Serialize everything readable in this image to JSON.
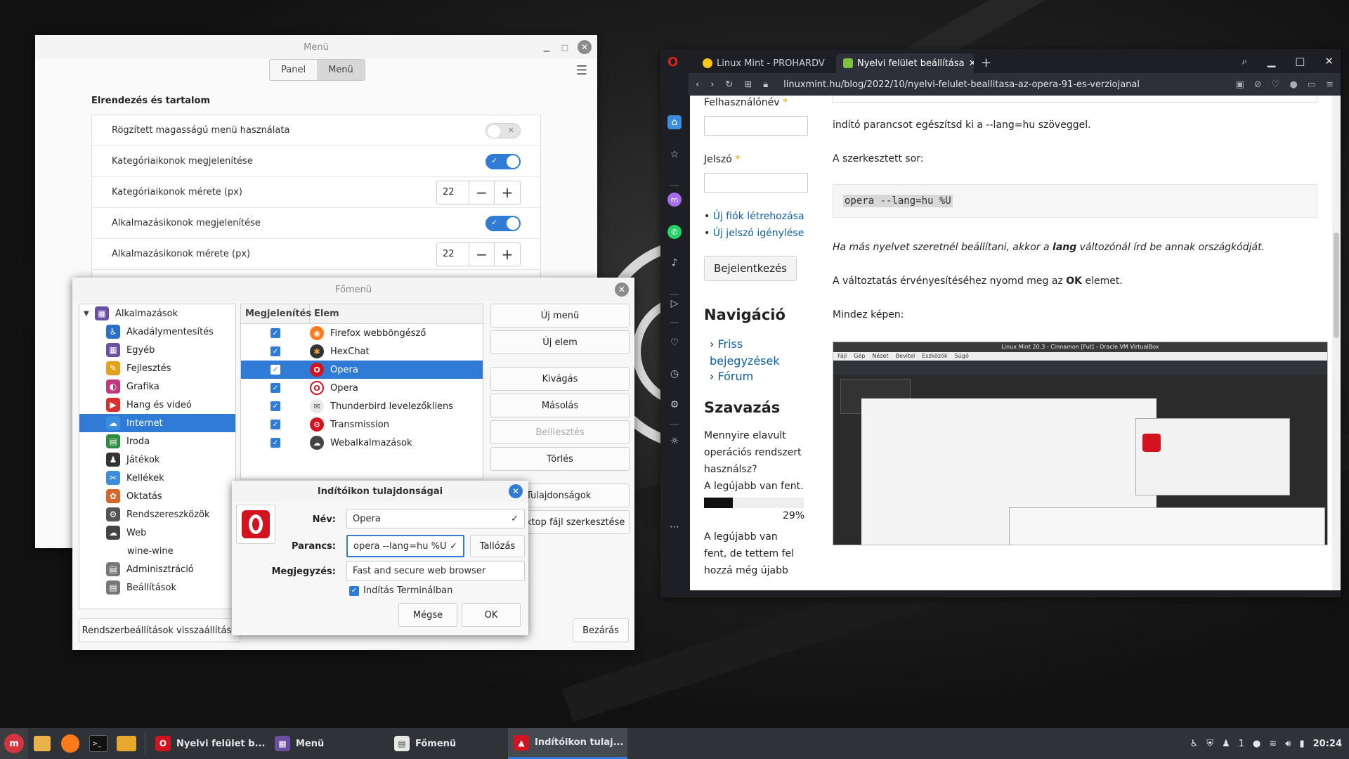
{
  "menu_window": {
    "title": "Menü",
    "tabs": [
      {
        "label": "Panel"
      },
      {
        "label": "Menü"
      }
    ],
    "section_title": "Elrendezés és tartalom",
    "rows": [
      {
        "label": "Rögzített magasságú menü használata",
        "type": "toggle",
        "on": false
      },
      {
        "label": "Kategóriaikonok megjelenítése",
        "type": "toggle",
        "on": true
      },
      {
        "label": "Kategóriaikonok mérete (px)",
        "type": "spin",
        "value": "22"
      },
      {
        "label": "Alkalmazásikonok megjelenítése",
        "type": "toggle",
        "on": true
      },
      {
        "label": "Alkalmazásikonok mérete (px)",
        "type": "spin",
        "value": "22"
      }
    ]
  },
  "fomenu_window": {
    "title": "Főmenü",
    "tree": [
      {
        "label": "Alkalmazások",
        "root": true,
        "color": "#6a4fa3",
        "glyph": "▦"
      },
      {
        "label": "Akadálymentesítés",
        "color": "#2a6fc9",
        "glyph": "♿"
      },
      {
        "label": "Egyéb",
        "color": "#6a4fa3",
        "glyph": "▦"
      },
      {
        "label": "Fejlesztés",
        "color": "#e3a21a",
        "glyph": "✎"
      },
      {
        "label": "Grafika",
        "color": "#c0397a",
        "glyph": "◐"
      },
      {
        "label": "Hang és videó",
        "color": "#d8302f",
        "glyph": "▶"
      },
      {
        "label": "Internet",
        "color": "#3b8ede",
        "glyph": "☁",
        "selected": true
      },
      {
        "label": "Iroda",
        "color": "#2e8a3c",
        "glyph": "▤"
      },
      {
        "label": "Játékok",
        "color": "#333",
        "glyph": "♟"
      },
      {
        "label": "Kellékek",
        "color": "#3b8ede",
        "glyph": "✂"
      },
      {
        "label": "Oktatás",
        "color": "#d7662a",
        "glyph": "✿"
      },
      {
        "label": "Rendszereszközök",
        "color": "#555",
        "glyph": "⚙"
      },
      {
        "label": "Web",
        "color": "#444",
        "glyph": "☁"
      },
      {
        "label": "wine-wine",
        "noicon": true
      },
      {
        "label": "Adminisztráció",
        "color": "#777",
        "glyph": "▤"
      },
      {
        "label": "Beállítások",
        "color": "#777",
        "glyph": "▤"
      }
    ],
    "columns": [
      "Megjelenítés",
      "Elem"
    ],
    "items": [
      {
        "label": "Firefox webböngésző",
        "bg": "#ff7a1a",
        "fg": "#fff",
        "glyph": "◉"
      },
      {
        "label": "HexChat",
        "bg": "#333",
        "fg": "#f0a030",
        "glyph": "✱"
      },
      {
        "label": "Opera",
        "bg": "#d3131f",
        "fg": "#fff",
        "glyph": "O",
        "selected": true
      },
      {
        "label": "Opera",
        "bg": "#fff",
        "fg": "#d3131f",
        "glyph": "O"
      },
      {
        "label": "Thunderbird levelezőkliens",
        "bg": "#e8e8e8",
        "fg": "#555",
        "glyph": "✉"
      },
      {
        "label": "Transmission",
        "bg": "#d3131f",
        "fg": "#fff",
        "glyph": "⚙"
      },
      {
        "label": "Webalkalmazások",
        "bg": "#444",
        "fg": "#fff",
        "glyph": "☁"
      }
    ],
    "buttons": {
      "new_menu": "Új menü",
      "new_item": "Új elem",
      "cut": "Kivágás",
      "copy": "Másolás",
      "paste": "Beillesztés",
      "delete": "Törlés",
      "properties": "Tulajdonságok",
      "edit_desktop": "ktop fájl szerkesztése",
      "reset": "Rendszerbeállítások visszaállítása",
      "close": "Bezárás"
    }
  },
  "launcher_dialog": {
    "title": "Indítóikon tulajdonságai",
    "name_label": "Név:",
    "name_value": "Opera",
    "command_label": "Parancs:",
    "command_value": "opera --lang=hu %U",
    "browse_label": "Tallózás",
    "comment_label": "Megjegyzés:",
    "comment_value": "Fast and secure web browser",
    "terminal_label": "Indítás Terminálban",
    "cancel_label": "Mégse",
    "ok_label": "OK"
  },
  "browser": {
    "tabs": [
      {
        "label": "Linux Mint - PROHARDV",
        "color": "#f5c518"
      },
      {
        "label": "Nyelvi felület beállítása",
        "color": "#7cc142",
        "active": true
      }
    ],
    "url": "linuxmint.hu/blog/2022/10/nyelvi-felulet-beallitasa-az-opera-91-es-verziojanal",
    "page": {
      "username_label": "Felhasználónév",
      "password_label": "Jelszó",
      "required_mark": "*",
      "link_register": "Új fiók létrehozása",
      "link_newpass": "Új jelszó igénylése",
      "login_button": "Bejelentkezés",
      "nav_heading": "Navigáció",
      "nav_links": [
        "Friss bejegyzések",
        "Fórum"
      ],
      "poll_heading": "Szavazás",
      "poll_question": "Mennyire elavult operációs rendszert használsz?",
      "poll_option": "A legújabb van fent.",
      "poll_percent": "29%",
      "poll_fraction": 0.29,
      "poll_option2": "A legújabb van fent, de tettem fel hozzá még újabb",
      "p1": "indító parancsot egészítsd ki a --lang=hu szöveggel.",
      "p2": "A szerkesztett sor:",
      "code": "opera --lang=hu %U",
      "p3_a": "Ha más nyelvet szeretnél beállítani, akkor a ",
      "p3_b": "lang",
      "p3_c": " változónál írd be annak országkódját.",
      "p4_a": "A változtatás érvényesítéséhez nyomd meg az ",
      "p4_b": "OK",
      "p4_c": " elemet.",
      "p5": "Mindez képen:",
      "shot_title": "Linux Mint 20.3 - Cinnamon [Fut] - Oracle VM VirtualBox",
      "shot_menu": [
        "Fájl",
        "Gép",
        "Nézet",
        "Bevitel",
        "Eszközök",
        "Súgó"
      ]
    }
  },
  "taskbar": {
    "tasks": [
      {
        "label": "Nyelvi felület b..."
      },
      {
        "label": "Menü"
      },
      {
        "label": "Főmenü"
      },
      {
        "label": "Indítóikon tulaj...",
        "active": true
      }
    ],
    "workspace": "1",
    "clock": "20:24"
  }
}
